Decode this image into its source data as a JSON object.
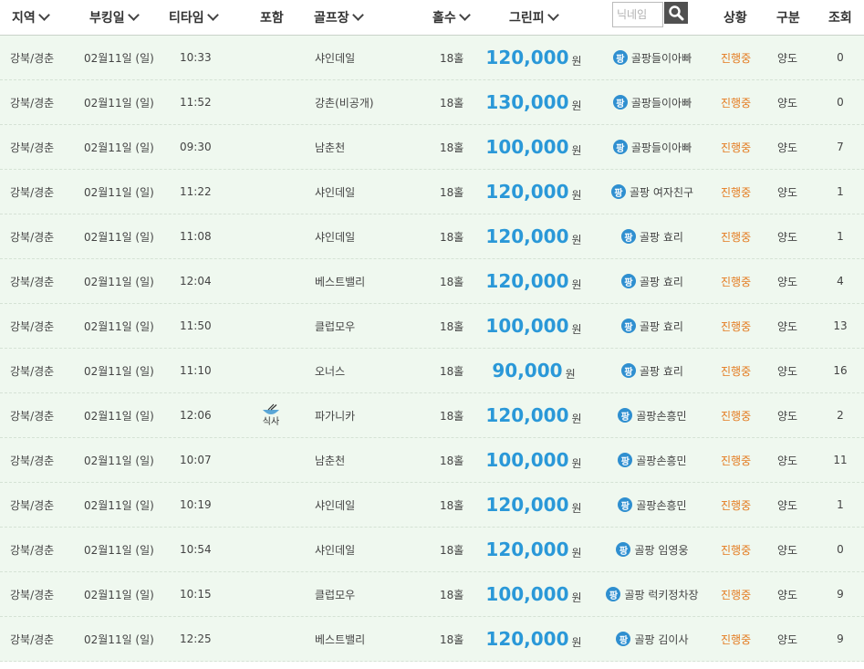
{
  "header": {
    "region": "지역",
    "booking_date": "부킹일",
    "tee_time": "티타임",
    "included": "포함",
    "golf_course": "골프장",
    "holes": "홀수",
    "green_fee": "그린피",
    "status": "상황",
    "kind": "구분",
    "views": "조회",
    "search_placeholder": "닉네임"
  },
  "currency_unit": "원",
  "host_badge": "팡",
  "rows": [
    {
      "region": "강북/경춘",
      "date": "02월11일 (일)",
      "time": "10:33",
      "meal": "",
      "course": "샤인데일",
      "holes": "18홀",
      "fee": "120,000",
      "host": "골팡들이아빠",
      "status": "진행중",
      "kind": "양도",
      "views": "0"
    },
    {
      "region": "강북/경춘",
      "date": "02월11일 (일)",
      "time": "11:52",
      "meal": "",
      "course": "강촌(비공개)",
      "holes": "18홀",
      "fee": "130,000",
      "host": "골팡들이아빠",
      "status": "진행중",
      "kind": "양도",
      "views": "0"
    },
    {
      "region": "강북/경춘",
      "date": "02월11일 (일)",
      "time": "09:30",
      "meal": "",
      "course": "남춘천",
      "holes": "18홀",
      "fee": "100,000",
      "host": "골팡들이아빠",
      "status": "진행중",
      "kind": "양도",
      "views": "7"
    },
    {
      "region": "강북/경춘",
      "date": "02월11일 (일)",
      "time": "11:22",
      "meal": "",
      "course": "샤인데일",
      "holes": "18홀",
      "fee": "120,000",
      "host": "골팡 여자친구",
      "status": "진행중",
      "kind": "양도",
      "views": "1"
    },
    {
      "region": "강북/경춘",
      "date": "02월11일 (일)",
      "time": "11:08",
      "meal": "",
      "course": "샤인데일",
      "holes": "18홀",
      "fee": "120,000",
      "host": "골팡 효리",
      "status": "진행중",
      "kind": "양도",
      "views": "1"
    },
    {
      "region": "강북/경춘",
      "date": "02월11일 (일)",
      "time": "12:04",
      "meal": "",
      "course": "베스트밸리",
      "holes": "18홀",
      "fee": "120,000",
      "host": "골팡 효리",
      "status": "진행중",
      "kind": "양도",
      "views": "4"
    },
    {
      "region": "강북/경춘",
      "date": "02월11일 (일)",
      "time": "11:50",
      "meal": "",
      "course": "클럽모우",
      "holes": "18홀",
      "fee": "100,000",
      "host": "골팡 효리",
      "status": "진행중",
      "kind": "양도",
      "views": "13"
    },
    {
      "region": "강북/경춘",
      "date": "02월11일 (일)",
      "time": "11:10",
      "meal": "",
      "course": "오너스",
      "holes": "18홀",
      "fee": "90,000",
      "host": "골팡 효리",
      "status": "진행중",
      "kind": "양도",
      "views": "16"
    },
    {
      "region": "강북/경춘",
      "date": "02월11일 (일)",
      "time": "12:06",
      "meal": "식사",
      "course": "파가니카",
      "holes": "18홀",
      "fee": "120,000",
      "host": "골팡손흥민",
      "status": "진행중",
      "kind": "양도",
      "views": "2"
    },
    {
      "region": "강북/경춘",
      "date": "02월11일 (일)",
      "time": "10:07",
      "meal": "",
      "course": "남춘천",
      "holes": "18홀",
      "fee": "100,000",
      "host": "골팡손흥민",
      "status": "진행중",
      "kind": "양도",
      "views": "11"
    },
    {
      "region": "강북/경춘",
      "date": "02월11일 (일)",
      "time": "10:19",
      "meal": "",
      "course": "샤인데일",
      "holes": "18홀",
      "fee": "120,000",
      "host": "골팡손흥민",
      "status": "진행중",
      "kind": "양도",
      "views": "1"
    },
    {
      "region": "강북/경춘",
      "date": "02월11일 (일)",
      "time": "10:54",
      "meal": "",
      "course": "샤인데일",
      "holes": "18홀",
      "fee": "120,000",
      "host": "골팡 임영웅",
      "status": "진행중",
      "kind": "양도",
      "views": "0"
    },
    {
      "region": "강북/경춘",
      "date": "02월11일 (일)",
      "time": "10:15",
      "meal": "",
      "course": "클럽모우",
      "holes": "18홀",
      "fee": "100,000",
      "host": "골팡 럭키정차장",
      "status": "진행중",
      "kind": "양도",
      "views": "9"
    },
    {
      "region": "강북/경춘",
      "date": "02월11일 (일)",
      "time": "12:25",
      "meal": "",
      "course": "베스트밸리",
      "holes": "18홀",
      "fee": "120,000",
      "host": "골팡 김이사",
      "status": "진행중",
      "kind": "양도",
      "views": "9"
    }
  ]
}
